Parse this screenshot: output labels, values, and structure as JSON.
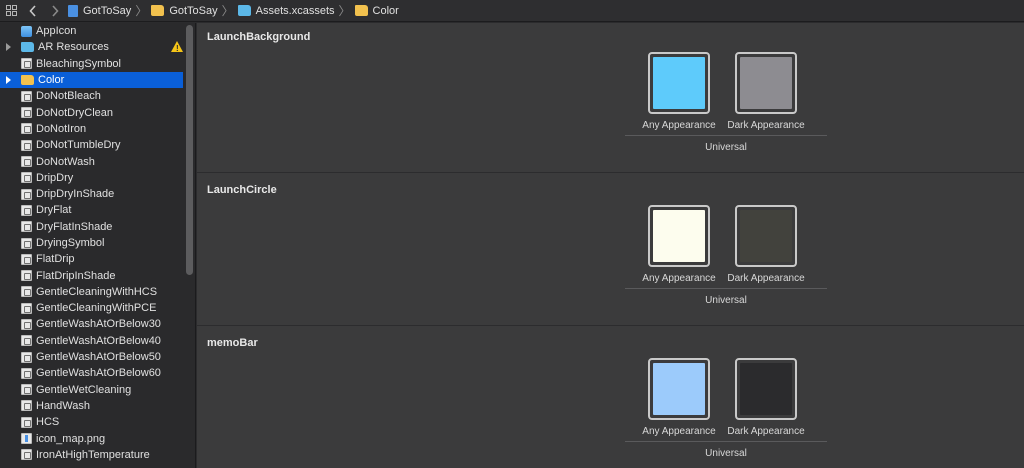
{
  "jumpbar": {
    "crumbs": [
      {
        "label": "GotToSay",
        "icon": "project-file-icon"
      },
      {
        "label": "GotToSay",
        "icon": "folder-icon"
      },
      {
        "label": "Assets.xcassets",
        "icon": "asset-catalog-icon"
      },
      {
        "label": "Color",
        "icon": "folder-icon"
      }
    ]
  },
  "sidebar": {
    "items": [
      {
        "label": "AppIcon",
        "icon": "appicon-icon"
      },
      {
        "label": "AR Resources",
        "icon": "folder-icon",
        "warning": true
      },
      {
        "label": "BleachingSymbol",
        "icon": "imageset-icon"
      },
      {
        "label": "Color",
        "icon": "folder-icon",
        "selected": true
      },
      {
        "label": "DoNotBleach",
        "icon": "imageset-icon"
      },
      {
        "label": "DoNotDryClean",
        "icon": "imageset-icon"
      },
      {
        "label": "DoNotIron",
        "icon": "imageset-icon"
      },
      {
        "label": "DoNotTumbleDry",
        "icon": "imageset-icon"
      },
      {
        "label": "DoNotWash",
        "icon": "imageset-icon"
      },
      {
        "label": "DripDry",
        "icon": "imageset-icon"
      },
      {
        "label": "DripDryInShade",
        "icon": "imageset-icon"
      },
      {
        "label": "DryFlat",
        "icon": "imageset-icon"
      },
      {
        "label": "DryFlatInShade",
        "icon": "imageset-icon"
      },
      {
        "label": "DryingSymbol",
        "icon": "imageset-icon"
      },
      {
        "label": "FlatDrip",
        "icon": "imageset-icon"
      },
      {
        "label": "FlatDripInShade",
        "icon": "imageset-icon"
      },
      {
        "label": "GentleCleaningWithHCS",
        "icon": "imageset-icon"
      },
      {
        "label": "GentleCleaningWithPCE",
        "icon": "imageset-icon"
      },
      {
        "label": "GentleWashAtOrBelow30",
        "icon": "imageset-icon"
      },
      {
        "label": "GentleWashAtOrBelow40",
        "icon": "imageset-icon"
      },
      {
        "label": "GentleWashAtOrBelow50",
        "icon": "imageset-icon"
      },
      {
        "label": "GentleWashAtOrBelow60",
        "icon": "imageset-icon"
      },
      {
        "label": "GentleWetCleaning",
        "icon": "imageset-icon"
      },
      {
        "label": "HandWash",
        "icon": "imageset-icon"
      },
      {
        "label": "HCS",
        "icon": "imageset-icon"
      },
      {
        "label": "icon_map.png",
        "icon": "png-file-icon"
      },
      {
        "label": "IronAtHighTemperature",
        "icon": "imageset-icon"
      }
    ]
  },
  "colorsets": [
    {
      "name": "LaunchBackground",
      "any_label": "Any Appearance",
      "dark_label": "Dark Appearance",
      "group_label": "Universal",
      "any_color": "#5ecbfb",
      "dark_color": "#8d8c91"
    },
    {
      "name": "LaunchCircle",
      "any_label": "Any Appearance",
      "dark_label": "Dark Appearance",
      "group_label": "Universal",
      "any_color": "#fdfdee",
      "dark_color": "#42423d"
    },
    {
      "name": "memoBar",
      "any_label": "Any Appearance",
      "dark_label": "Dark Appearance",
      "group_label": "Universal",
      "any_color": "#9ccbfb",
      "dark_color": "#2b2b2d"
    }
  ]
}
